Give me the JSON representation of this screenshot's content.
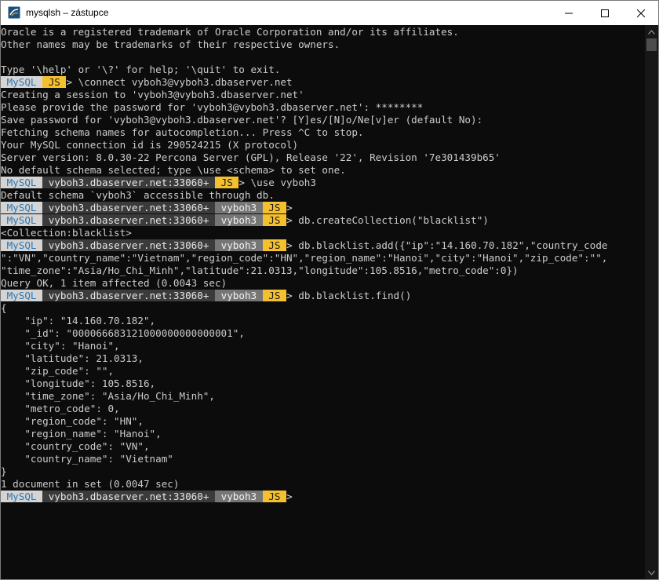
{
  "window": {
    "title": "mysqlsh – zástupce",
    "minimize": "minimize",
    "maximize": "maximize",
    "close": "close"
  },
  "colors": {
    "terminal_bg": "#0c0c0c",
    "terminal_text": "#cccccc",
    "prompt_mysql_bg": "#d4d4d4",
    "prompt_mysql_fg": "#2b77b5",
    "prompt_host_bg": "#3b3b3b",
    "prompt_schema_bg": "#767676",
    "prompt_js_bg": "#f4c02e"
  },
  "prompt": {
    "mysql": "MySQL",
    "js": "JS",
    "host": "vyboh3.dbaserver.net:33060+",
    "schema": "vyboh3"
  },
  "lines": [
    {
      "type": "text",
      "text": "Oracle is a registered trademark of Oracle Corporation and/or its affiliates."
    },
    {
      "type": "text",
      "text": "Other names may be trademarks of their respective owners."
    },
    {
      "type": "text",
      "text": ""
    },
    {
      "type": "text",
      "text": "Type '\\help' or '\\?' for help; '\\quit' to exit."
    },
    {
      "type": "prompt",
      "host": false,
      "schema": false,
      "cmd": "\\connect vyboh3@vyboh3.dbaserver.net"
    },
    {
      "type": "text",
      "text": "Creating a session to 'vyboh3@vyboh3.dbaserver.net'"
    },
    {
      "type": "text",
      "text": "Please provide the password for 'vyboh3@vyboh3.dbaserver.net': ********"
    },
    {
      "type": "text",
      "text": "Save password for 'vyboh3@vyboh3.dbaserver.net'? [Y]es/[N]o/Ne[v]er (default No):"
    },
    {
      "type": "text",
      "text": "Fetching schema names for autocompletion... Press ^C to stop."
    },
    {
      "type": "text",
      "text": "Your MySQL connection id is 290524215 (X protocol)"
    },
    {
      "type": "text",
      "text": "Server version: 8.0.30-22 Percona Server (GPL), Release '22', Revision '7e301439b65'"
    },
    {
      "type": "text",
      "text": "No default schema selected; type \\use <schema> to set one."
    },
    {
      "type": "prompt",
      "host": true,
      "schema": false,
      "cmd": "\\use vyboh3"
    },
    {
      "type": "text",
      "text": "Default schema `vyboh3` accessible through db."
    },
    {
      "type": "prompt",
      "host": true,
      "schema": true,
      "cmd": ""
    },
    {
      "type": "prompt",
      "host": true,
      "schema": true,
      "cmd": "db.createCollection(\"blacklist\")"
    },
    {
      "type": "text",
      "text": "<Collection:blacklist>"
    },
    {
      "type": "prompt",
      "host": true,
      "schema": true,
      "cmd": "db.blacklist.add({\"ip\":\"14.160.70.182\",\"country_code"
    },
    {
      "type": "text",
      "text": "\":\"VN\",\"country_name\":\"Vietnam\",\"region_code\":\"HN\",\"region_name\":\"Hanoi\",\"city\":\"Hanoi\",\"zip_code\":\"\","
    },
    {
      "type": "text",
      "text": "\"time_zone\":\"Asia/Ho_Chi_Minh\",\"latitude\":21.0313,\"longitude\":105.8516,\"metro_code\":0})"
    },
    {
      "type": "text",
      "text": "Query OK, 1 item affected (0.0043 sec)"
    },
    {
      "type": "prompt",
      "host": true,
      "schema": true,
      "cmd": "db.blacklist.find()"
    },
    {
      "type": "text",
      "text": "{"
    },
    {
      "type": "text",
      "text": "    \"ip\": \"14.160.70.182\","
    },
    {
      "type": "text",
      "text": "    \"_id\": \"000066683121000000000000001\","
    },
    {
      "type": "text",
      "text": "    \"city\": \"Hanoi\","
    },
    {
      "type": "text",
      "text": "    \"latitude\": 21.0313,"
    },
    {
      "type": "text",
      "text": "    \"zip_code\": \"\","
    },
    {
      "type": "text",
      "text": "    \"longitude\": 105.8516,"
    },
    {
      "type": "text",
      "text": "    \"time_zone\": \"Asia/Ho_Chi_Minh\","
    },
    {
      "type": "text",
      "text": "    \"metro_code\": 0,"
    },
    {
      "type": "text",
      "text": "    \"region_code\": \"HN\","
    },
    {
      "type": "text",
      "text": "    \"region_name\": \"Hanoi\","
    },
    {
      "type": "text",
      "text": "    \"country_code\": \"VN\","
    },
    {
      "type": "text",
      "text": "    \"country_name\": \"Vietnam\""
    },
    {
      "type": "text",
      "text": "}"
    },
    {
      "type": "text",
      "text": "1 document in set (0.0047 sec)"
    },
    {
      "type": "prompt",
      "host": true,
      "schema": true,
      "cmd": ""
    }
  ]
}
